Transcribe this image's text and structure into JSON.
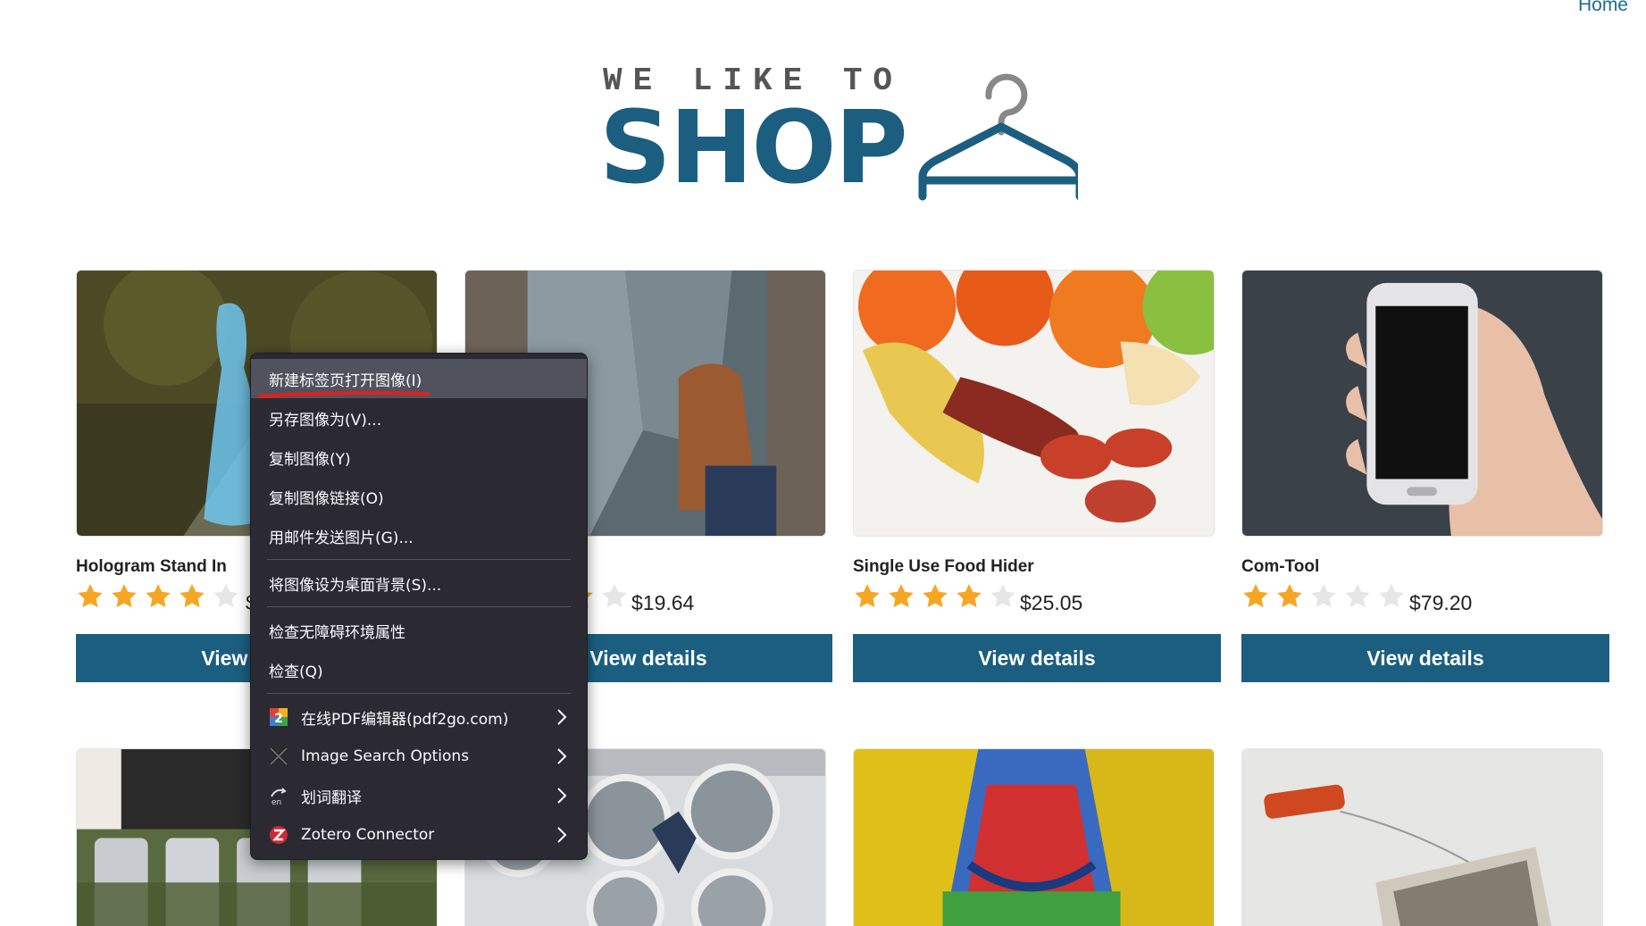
{
  "nav": {
    "home_label": "Home"
  },
  "logo": {
    "tagline": "WE LIKE TO",
    "wordmark": "SHOP"
  },
  "products": [
    {
      "title": "Hologram Stand In",
      "rating": 4,
      "price": "$",
      "button": "View details",
      "image": "hologram"
    },
    {
      "title": "",
      "rating": 4,
      "price": "$19.64",
      "button": "View details",
      "image": "city-feet"
    },
    {
      "title": "Single Use Food Hider",
      "rating": 4,
      "price": "$25.05",
      "button": "View details",
      "image": "food"
    },
    {
      "title": "Com-Tool",
      "rating": 2,
      "price": "$79.20",
      "button": "View details",
      "image": "phone"
    }
  ],
  "row2_images": [
    "can-belt",
    "laundromat",
    "bounce-house",
    "tea-bag"
  ],
  "context_menu": {
    "items": [
      {
        "label": "新建标签页打开图像(I)",
        "highlighted": true
      },
      {
        "label": "另存图像为(V)..."
      },
      {
        "label": "复制图像(Y)"
      },
      {
        "label": "复制图像链接(O)"
      },
      {
        "label": "用邮件发送图片(G)..."
      },
      {
        "separator": true
      },
      {
        "label": "将图像设为桌面背景(S)..."
      },
      {
        "separator": true
      },
      {
        "label": "检查无障碍环境属性"
      },
      {
        "label": "检查(Q)"
      },
      {
        "separator": true
      },
      {
        "label": "在线PDF编辑器(pdf2go.com)",
        "icon": "pdf2go-icon",
        "submenu": true
      },
      {
        "label": "Image Search Options",
        "icon": "image-search-icon",
        "submenu": true
      },
      {
        "label": "划词翻译",
        "icon": "translate-icon",
        "submenu": true
      },
      {
        "label": "Zotero Connector",
        "icon": "zotero-icon",
        "submenu": true
      }
    ]
  },
  "colors": {
    "brand": "#1b5e80",
    "star_on": "#f5a623",
    "star_off": "#e6e6e6",
    "menu_bg": "#2b2a33",
    "annotation": "#e02020"
  }
}
